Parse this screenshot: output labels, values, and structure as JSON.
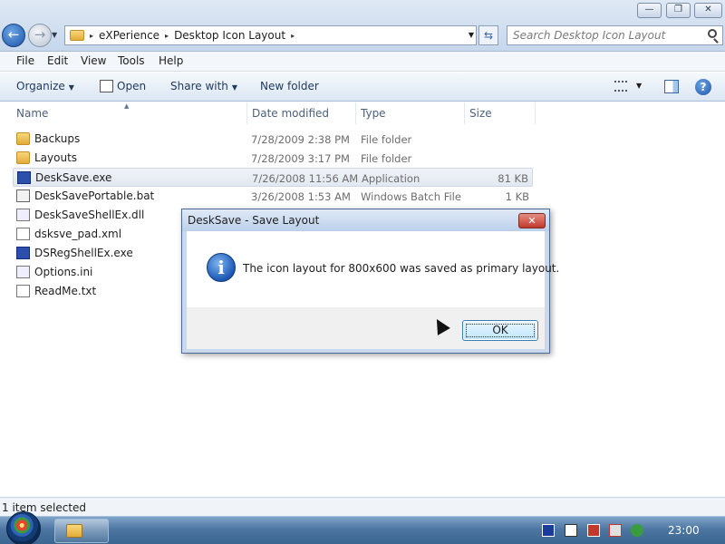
{
  "window": {
    "minimize_glyph": "—",
    "maximize_glyph": "❐",
    "close_glyph": "✕"
  },
  "navigation": {
    "back_glyph": "←",
    "forward_glyph": "→",
    "recent_glyph": "▼",
    "breadcrumb": [
      "eXPerience",
      "Desktop Icon Layout"
    ],
    "separator_glyph": "▸",
    "dropdown_glyph": "▼",
    "refresh_glyph": "⇆"
  },
  "search": {
    "placeholder": "Search Desktop Icon Layout"
  },
  "menubar": {
    "items": [
      "File",
      "Edit",
      "View",
      "Tools",
      "Help"
    ]
  },
  "toolbar": {
    "organize_label": "Organize",
    "open_label": "Open",
    "share_label": "Share with",
    "new_folder_label": "New folder",
    "caret_glyph": "▼",
    "help_glyph": "?"
  },
  "columns": {
    "name": "Name",
    "date_modified": "Date modified",
    "type": "Type",
    "size": "Size",
    "sort_glyph": "▲"
  },
  "files": [
    {
      "name": "Backups",
      "date": "7/28/2009 2:38 PM",
      "type": "File folder",
      "size": "",
      "icon": "folder-icon"
    },
    {
      "name": "Layouts",
      "date": "7/28/2009 3:17 PM",
      "type": "File folder",
      "size": "",
      "icon": "folder-icon"
    },
    {
      "name": "DeskSave.exe",
      "date": "7/26/2008 11:56 AM",
      "type": "Application",
      "size": "81 KB",
      "icon": "application-icon"
    },
    {
      "name": "DeskSavePortable.bat",
      "date": "3/26/2008 1:53 AM",
      "type": "Windows Batch File",
      "size": "1 KB",
      "icon": "batch-file-icon"
    },
    {
      "name": "DeskSaveShellEx.dll",
      "date": "",
      "type": "",
      "size": "",
      "icon": "dll-icon"
    },
    {
      "name": "dsksve_pad.xml",
      "date": "",
      "type": "",
      "size": "",
      "icon": "xml-file-icon"
    },
    {
      "name": "DSRegShellEx.exe",
      "date": "",
      "type": "",
      "size": "",
      "icon": "application-icon"
    },
    {
      "name": "Options.ini",
      "date": "",
      "type": "",
      "size": "",
      "icon": "ini-file-icon"
    },
    {
      "name": "ReadMe.txt",
      "date": "",
      "type": "",
      "size": "",
      "icon": "text-file-icon"
    }
  ],
  "status": {
    "text": "1 item selected"
  },
  "dialog": {
    "title": "DeskSave - Save Layout",
    "close_glyph": "✕",
    "icon_glyph": "i",
    "message": "The icon layout for 800x600 was saved as primary layout.",
    "ok_label": "OK"
  },
  "taskbar": {
    "clock": "23:00"
  },
  "colors": {
    "accent": "#3c7fb1",
    "taskbar": "#4d76a2",
    "dialog_close": "#c0392b"
  }
}
